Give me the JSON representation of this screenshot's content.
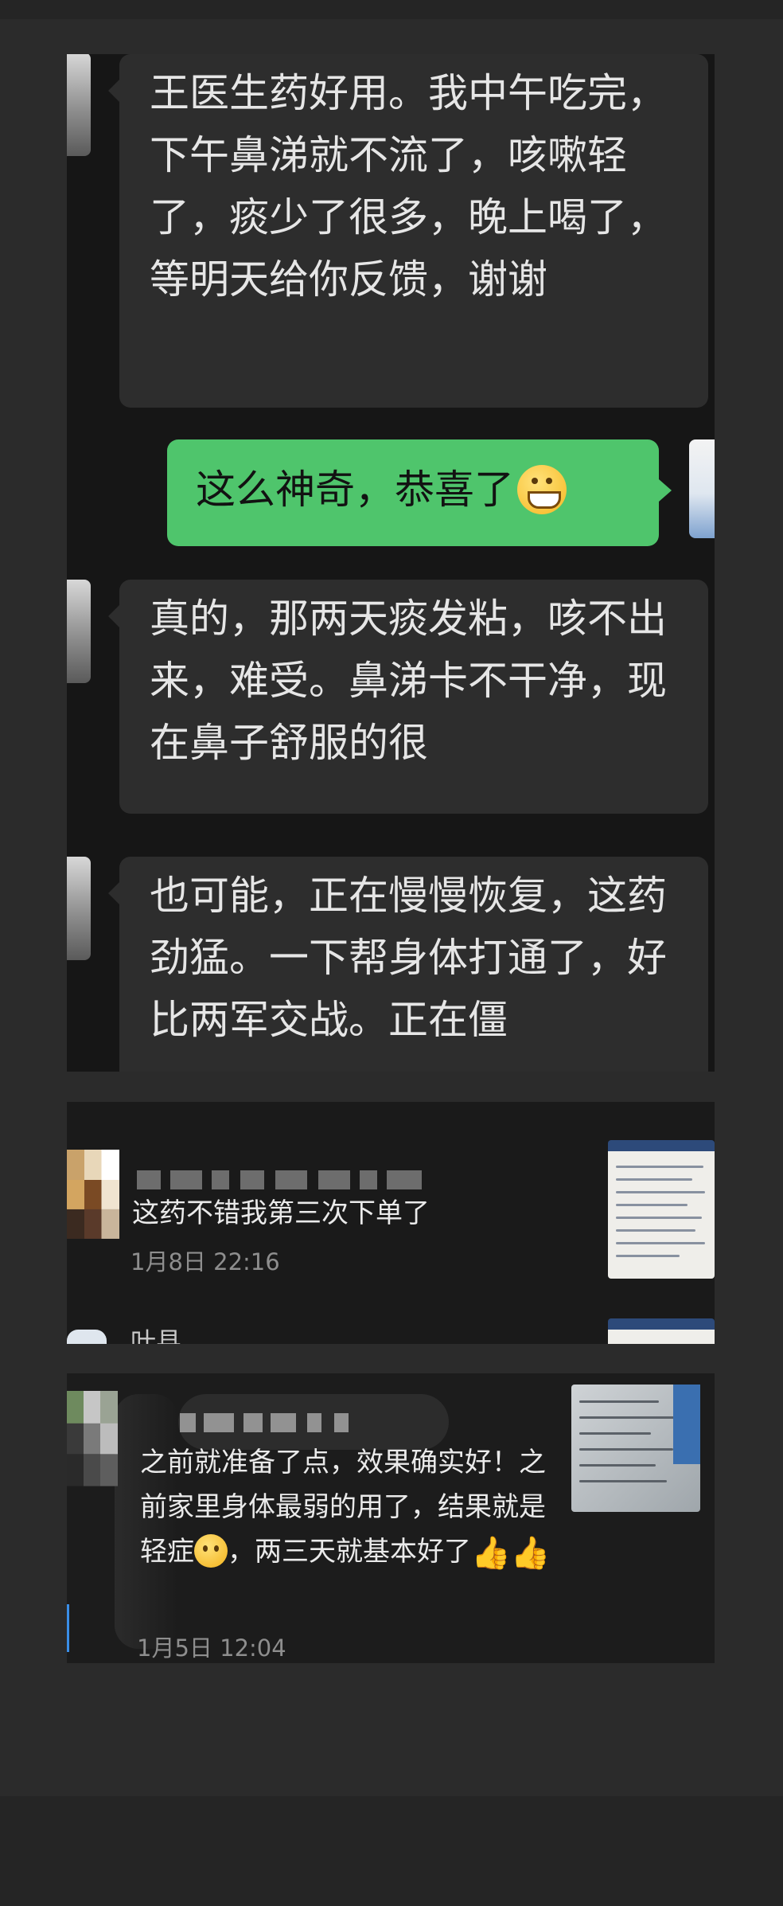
{
  "chat": {
    "messages": [
      {
        "side": "in",
        "text": "王医生药好用。我中午吃完，下午鼻涕就不流了，咳嗽轻了，痰少了很多，晚上喝了，等明天给你反馈，谢谢"
      },
      {
        "side": "out",
        "text": "这么神奇，恭喜了",
        "emoji": "grinning-face"
      },
      {
        "side": "in",
        "text": "真的，那两天痰发粘，咳不出来，难受。鼻涕卡不干净，现在鼻子舒服的很"
      },
      {
        "side": "in",
        "text": "也可能，正在慢慢恢复，这药劲猛。一下帮身体打通了，好比两军交战。正在僵"
      }
    ]
  },
  "review_1": {
    "text": "这药不错我第三次下单了",
    "time": "1月8日 22:16",
    "next_name_partial": "叶县"
  },
  "review_2": {
    "text": "之前就准备了点，效果确实好！之前家里身体最弱的用了，结果就是轻症",
    "text_after_emoji": "，两三天就基本好了",
    "emoji_1": "smiling-face",
    "emoji_2": "thumbs-up",
    "time": "1月5日 12:04"
  }
}
